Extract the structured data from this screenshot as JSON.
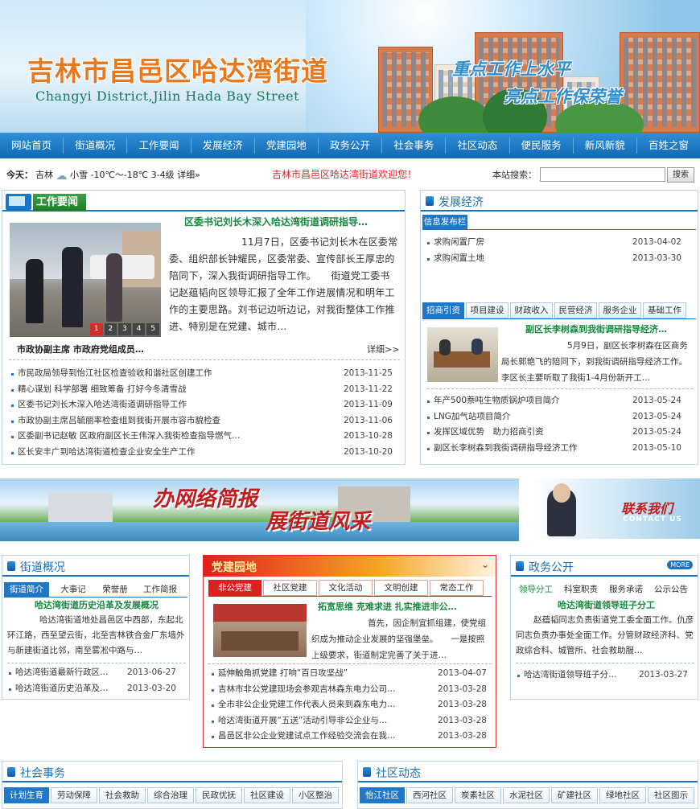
{
  "header": {
    "title_cn": "吉林市昌邑区哈达湾街道",
    "title_en": "Changyi District,Jilin Hada Bay Street",
    "slogan1": "重点工作上水平",
    "slogan2": "亮点工作保荣誉"
  },
  "nav": [
    "网站首页",
    "街道概况",
    "工作要闻",
    "发展经济",
    "党建园地",
    "政务公开",
    "社会事务",
    "社区动态",
    "便民服务",
    "新风新貌",
    "百姓之窗"
  ],
  "infobar": {
    "today": "今天：",
    "city": "吉林",
    "weather": "小雪",
    "temp": "-10℃～-18℃ 3-4级",
    "detail": "详细»",
    "welcome": "吉林市昌邑区哈达湾街道欢迎您！",
    "search_label": "本站搜索：",
    "search_value": "",
    "search_button": "搜索"
  },
  "news": {
    "title": "工作要闻",
    "headline": "区委书记刘长木深入哈达湾街道调研指导…",
    "summary": "11月7日，区委书记刘长木在区委常委、组织部长钟耀民，区委常委、宣传部长王厚忠的陪同下，深入我街调研指导工作。　　街道党工委书记赵蕴韬向区领导汇报了全年工作进展情况和明年工作的主要思路。刘书记边听边记，对我街整体工作推进、特别是在党建、城市…",
    "caption": "市政协副主席 市政府党组成员…",
    "more": "详细>>",
    "pages": [
      "1",
      "2",
      "3",
      "4",
      "5"
    ],
    "items": [
      {
        "title": "市民政局领导到怡江社区检查验收和谐社区创建工作",
        "date": "2013-11-25"
      },
      {
        "title": "精心谋划 科学部署 细致筹备 打好今冬清雪战",
        "date": "2013-11-22"
      },
      {
        "title": "区委书记刘长木深入哈达湾街道调研指导工作",
        "date": "2013-11-09"
      },
      {
        "title": "市政协副主席吕毓丽率检查组到我街开展市容市貌检查",
        "date": "2013-11-06"
      },
      {
        "title": "区委副书记赵敏 区政府副区长王伟深入我街检查指导燃气…",
        "date": "2013-10-28"
      },
      {
        "title": "区长安丰广到哈达湾街道检查企业安全生产工作",
        "date": "2013-10-20"
      }
    ]
  },
  "economy": {
    "title": "发展经济",
    "info_tab": "信息发布栏",
    "info_items": [
      {
        "title": "求购闲置厂房",
        "date": "2013-04-02"
      },
      {
        "title": "求购闲置土地",
        "date": "2013-03-30"
      }
    ],
    "tabs": [
      "招商引资",
      "项目建设",
      "财政收入",
      "民营经济",
      "服务企业",
      "基础工作"
    ],
    "headline": "副区长李树森到我街调研指导经济…",
    "summary": "5月9日，副区长李树森在区商务局长郭艳飞的陪同下，到我街调研指导经济工作。　　李区长主要听取了我街1-4月份新开工…",
    "items": [
      {
        "title": "年产500萘吨生物质锅炉项目简介",
        "date": "2013-05-24"
      },
      {
        "title": "LNG加气站项目简介",
        "date": "2013-05-24"
      },
      {
        "title": "发挥区域优势　助力招商引资",
        "date": "2013-05-24"
      },
      {
        "title": "副区长李树森到我街调研指导经济工作",
        "date": "2013-05-10"
      }
    ]
  },
  "banner": {
    "text1": "办网络简报",
    "text2": "展街道风采",
    "contact_cn": "联系我们",
    "contact_en": "CONTACT US"
  },
  "overview": {
    "title": "街道概况",
    "tabs": [
      "街道简介",
      "大事记",
      "荣誉册",
      "工作简报"
    ],
    "headline": "哈达湾街道历史沿革及发展概况",
    "summary": "哈达湾街道地处昌邑区中西部，东起北环江路，西至望云街，北至吉林铁合金厂东墙外与新建街道比邻，南至雾凇中路与…",
    "items": [
      {
        "title": "哈达湾街道最新行政区…",
        "date": "2013-06-27"
      },
      {
        "title": "哈达湾街道历史沿革及…",
        "date": "2013-03-20"
      }
    ]
  },
  "party": {
    "title": "党建园地",
    "tabs": [
      "非公党建",
      "社区党建",
      "文化活动",
      "文明创建",
      "常态工作"
    ],
    "headline": "拓宽思维 克难求进 扎实推进非公…",
    "summary": "首先，因企制宜抓组建，使党组织成为推动企业发展的坚强堡垒。　　一是按照上级要求，街道制定完善了关于进…",
    "items": [
      {
        "title": "延伸触角抓党建 打响“百日攻坚战”",
        "date": "2013-04-07"
      },
      {
        "title": "吉林市非公党建现场会参观吉林森东电力公司…",
        "date": "2013-03-28"
      },
      {
        "title": "全市非公企业党建工作代表人员来到森东电力…",
        "date": "2013-03-28"
      },
      {
        "title": "哈达湾街道开展“五送”活动引导非公企业与…",
        "date": "2013-03-28"
      },
      {
        "title": "昌邑区非公企业党建试点工作经验交流会在我…",
        "date": "2013-03-28"
      }
    ]
  },
  "gov": {
    "title": "政务公开",
    "more": "MORE",
    "tabs": [
      "领导分工",
      "科室职责",
      "服务承诺",
      "公示公告"
    ],
    "headline": "哈达湾街道领导班子分工",
    "summary": "赵蕴韬同志负责街道党工委全面工作。仇彦同志负责办事处全面工作。分管财政经济科、党政综合科、城管所、社会救助服…",
    "items": [
      {
        "title": "哈达湾街道领导班子分…",
        "date": "2013-03-27"
      }
    ]
  },
  "social": {
    "title": "社会事务",
    "tabs": [
      "计划生育",
      "劳动保障",
      "社会救助",
      "综合治理",
      "民政优抚",
      "社区建设",
      "小区整治"
    ]
  },
  "community": {
    "title": "社区动态",
    "tabs": [
      "怡江社区",
      "西河社区",
      "炭素社区",
      "水泥社区",
      "矿建社区",
      "绿地社区",
      "社区图示"
    ]
  }
}
